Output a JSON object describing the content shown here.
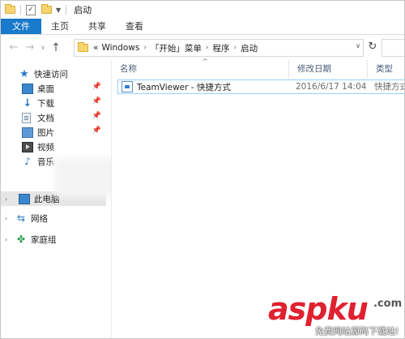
{
  "titlebar": {
    "title": "启动"
  },
  "ribbon": {
    "tabs": [
      "文件",
      "主页",
      "共享",
      "查看"
    ]
  },
  "address": {
    "overflow": "«",
    "crumbs": [
      "Windows",
      "「开始」菜单",
      "程序",
      "启动"
    ]
  },
  "navpane": {
    "quick_access": "快速访问",
    "items": [
      "桌面",
      "下载",
      "文档",
      "图片",
      "视频",
      "音乐"
    ],
    "this_pc": "此电脑",
    "network": "网络",
    "homegroup": "家庭组"
  },
  "columns": {
    "name": "名称",
    "date": "修改日期",
    "type": "类型"
  },
  "files": [
    {
      "name": "TeamViewer - 快捷方式",
      "date": "2016/6/17 14:04",
      "type": "快捷方式"
    }
  ],
  "watermark": {
    "brand": "aspku",
    "tld": ".com",
    "tagline": "免费网站源码下载站!"
  },
  "colors": {
    "file_tab": "#1979ca",
    "selection_border": "#99d1ff",
    "watermark_red": "#e0212f"
  }
}
